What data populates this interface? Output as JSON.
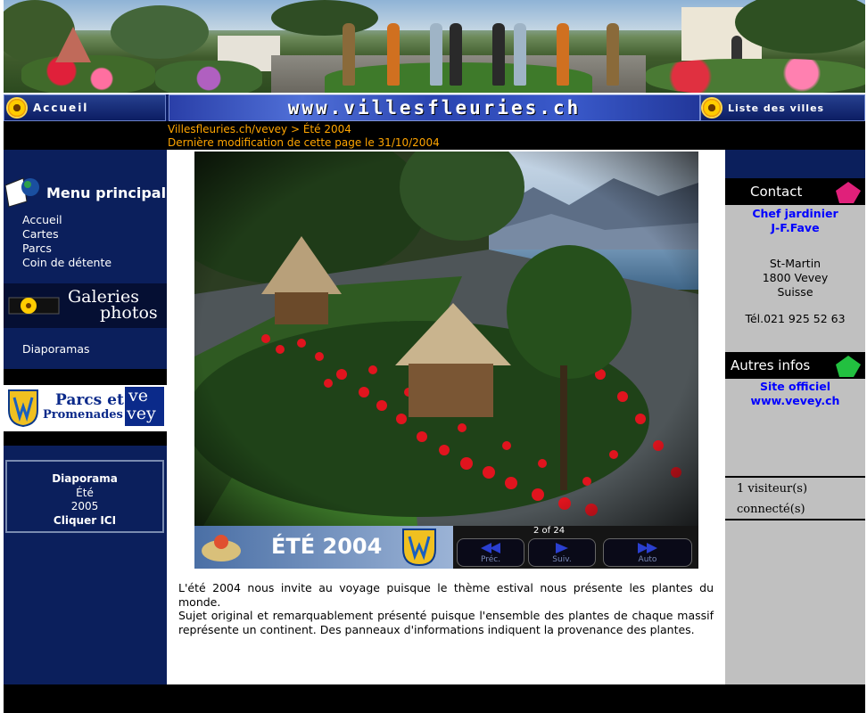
{
  "nav": {
    "home_label": "Accueil",
    "site_url": "www.villesfleuries.ch",
    "cities_label": "Liste des villes"
  },
  "breadcrumb": {
    "path": "Villesfleuries.ch/vevey > Été 2004",
    "modified": "Dernière modification de cette page le 31/10/2004"
  },
  "left_menu": {
    "title": "Menu principal",
    "items": [
      "Accueil",
      "Cartes",
      "Parcs",
      "Coin de détente"
    ],
    "gallery_title_1": "Galeries",
    "gallery_title_2": "photos",
    "gallery_items": [
      "Diaporamas"
    ],
    "parcs_logo_text_1": "Parcs et",
    "parcs_logo_text_2": "Promenades",
    "parcs_logo_text_3": "ve",
    "parcs_logo_text_4": "vey",
    "diaporama": {
      "line1": "Diaporama",
      "line2": "Été",
      "line3": "2005",
      "line4": "Cliquer ICI"
    }
  },
  "slideshow": {
    "title": "ÉTÉ 2004",
    "counter": "2 of 24",
    "prev_label": "Préc.",
    "next_label": "Suiv.",
    "auto_label": "Auto"
  },
  "body": {
    "paragraph1": "L'été 2004 nous invite au voyage puisque le thème estival nous présente les plantes du monde.",
    "paragraph2": "Sujet original et remarquablement présenté puisque l'ensemble des plantes de chaque massif représente un continent. Des panneaux d'informations indiquent la provenance des plantes."
  },
  "right": {
    "contact_title": "Contact",
    "gardener_line1": "Chef jardinier",
    "gardener_line2": "J-F.Fave",
    "address_line1": "St-Martin",
    "address_line2": "1800 Vevey",
    "address_line3": "Suisse",
    "phone": "Tél.021 925 52 63",
    "infos_title": "Autres infos",
    "site_line1": "Site officiel",
    "site_line2": "www.vevey.ch",
    "visitors_line1": "1 visiteur(s)",
    "visitors_line2": "connecté(s)"
  },
  "colors": {
    "nav_blue": "#0c1d63",
    "left_navy": "#0b1f5c",
    "crumb_orange": "#ffa500",
    "link_blue": "#0000ff",
    "right_grey": "#c0c0c0"
  }
}
